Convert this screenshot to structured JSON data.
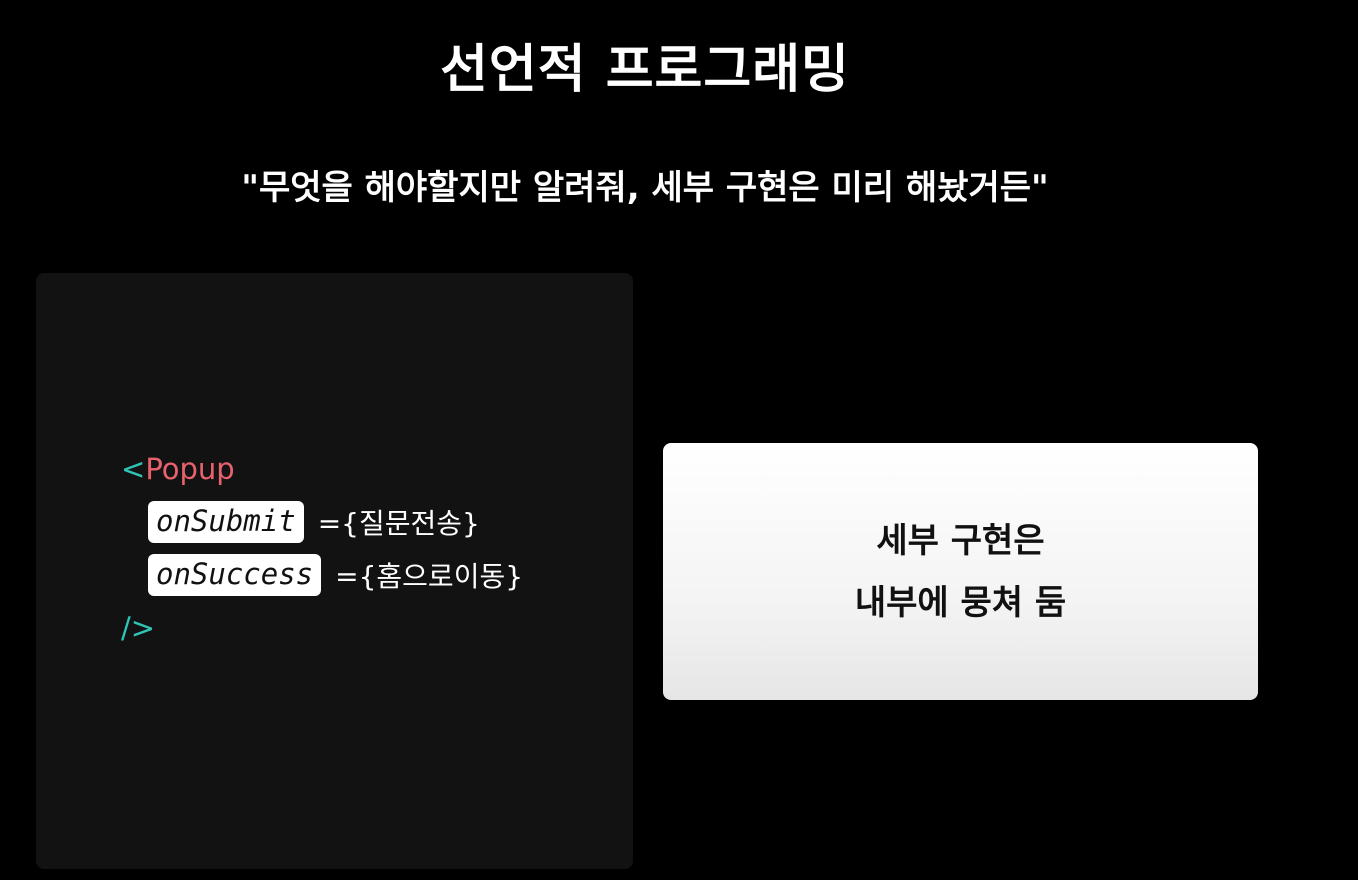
{
  "slide": {
    "title": "선언적 프로그래밍",
    "subtitle": "\"무엇을 해야할지만 알려줘, 세부 구현은 미리 해놨거든\""
  },
  "code": {
    "open_bracket": "<",
    "tag_name": "Popup",
    "props": [
      {
        "name": "onSubmit",
        "value": "={질문전송}"
      },
      {
        "name": "onSuccess",
        "value": "={홈으로이동}"
      }
    ],
    "close_tag": "/>"
  },
  "card": {
    "line1": "세부 구현은",
    "line2": "내부에 뭉쳐 둠"
  },
  "colors": {
    "background": "#000000",
    "code_panel": "#121212",
    "bracket": "#2ec4b6",
    "tag": "#e8626e",
    "card": "#ffffff"
  }
}
